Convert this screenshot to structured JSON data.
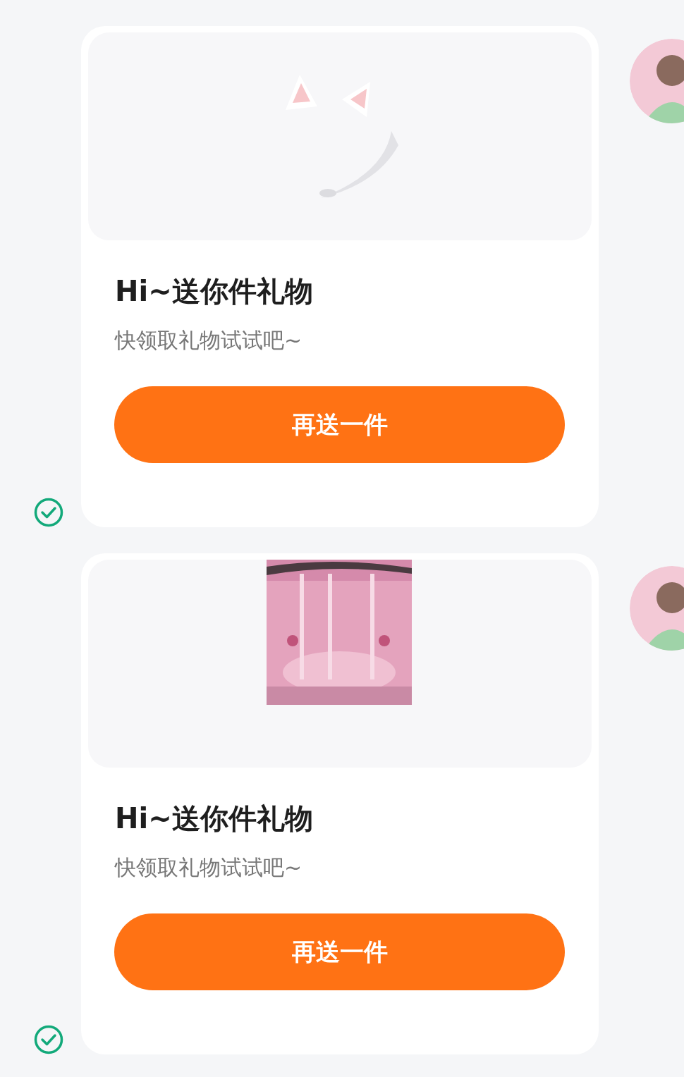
{
  "messages": [
    {
      "title": "Hi~送你件礼物",
      "subtitle": "快领取礼物试试吧~",
      "button": "再送一件",
      "sent": true
    },
    {
      "title": "Hi~送你件礼物",
      "subtitle": "快领取礼物试试吧~",
      "button": "再送一件",
      "sent": true
    }
  ]
}
